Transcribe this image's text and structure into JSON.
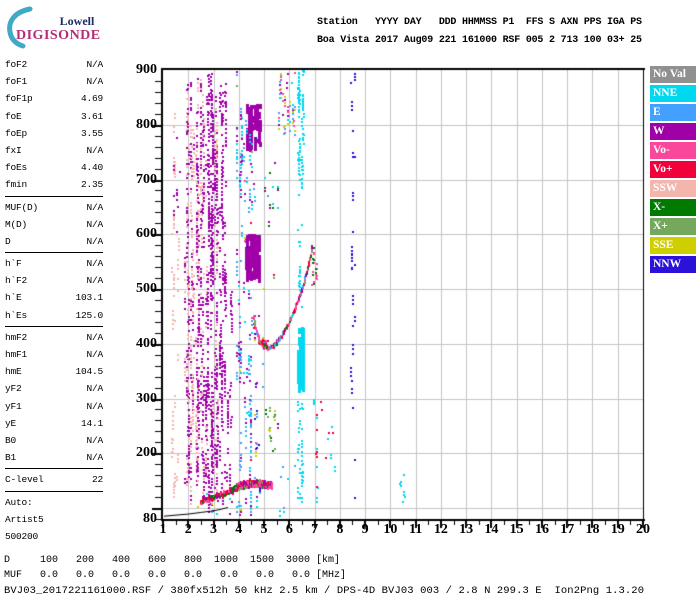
{
  "logo": {
    "line1": "Lowell",
    "line2": "DIGISONDE"
  },
  "header": {
    "line1": "Station   YYYY DAY   DDD HHMMSS P1  FFS S AXN PPS IGA PS",
    "line2": "Boa Vista 2017 Aug09 221 161000 RSF 005 2 713 100 03+ 25"
  },
  "params": [
    {
      "label": "foF2",
      "value": "N/A"
    },
    {
      "label": "foF1",
      "value": "N/A"
    },
    {
      "label": "foF1p",
      "value": "4.69"
    },
    {
      "label": "foE",
      "value": "3.61"
    },
    {
      "label": "foEp",
      "value": "3.55"
    },
    {
      "label": "fxI",
      "value": "N/A"
    },
    {
      "label": "foEs",
      "value": "4.40"
    },
    {
      "label": "fmin",
      "value": "2.35"
    },
    {
      "divider": true
    },
    {
      "label": "MUF(D)",
      "value": "N/A"
    },
    {
      "label": "M(D)",
      "value": "N/A"
    },
    {
      "label": "D",
      "value": "N/A"
    },
    {
      "divider": true
    },
    {
      "label": "h`F",
      "value": "N/A"
    },
    {
      "label": "h`F2",
      "value": "N/A"
    },
    {
      "label": "h`E",
      "value": "103.1"
    },
    {
      "label": "h`Es",
      "value": "125.0"
    },
    {
      "divider": true
    },
    {
      "label": "hmF2",
      "value": "N/A"
    },
    {
      "label": "hmF1",
      "value": "N/A"
    },
    {
      "label": "hmE",
      "value": "104.5"
    },
    {
      "label": "yF2",
      "value": "N/A"
    },
    {
      "label": "yF1",
      "value": "N/A"
    },
    {
      "label": "yE",
      "value": "14.1"
    },
    {
      "label": "B0",
      "value": "N/A"
    },
    {
      "label": "B1",
      "value": "N/A"
    },
    {
      "divider": true
    },
    {
      "label": "C-level",
      "value": "22"
    },
    {
      "divider": true
    },
    {
      "label": "Auto:",
      "value": ""
    },
    {
      "label": "Artist5",
      "value": ""
    },
    {
      "label": "500200",
      "value": ""
    }
  ],
  "legend": [
    {
      "key": "NoVal",
      "label": "No Val"
    },
    {
      "key": "NNE",
      "label": "NNE"
    },
    {
      "key": "E",
      "label": "E"
    },
    {
      "key": "W",
      "label": "W"
    },
    {
      "key": "Vo-",
      "label": "Vo-"
    },
    {
      "key": "Vo+",
      "label": "Vo+"
    },
    {
      "key": "SSW",
      "label": "SSW"
    },
    {
      "key": "X-",
      "label": "X-"
    },
    {
      "key": "X+",
      "label": "X+"
    },
    {
      "key": "SSE",
      "label": "SSE"
    },
    {
      "key": "NNW",
      "label": "NNW"
    }
  ],
  "footer": {
    "d_row": "D     100   200   400   600   800  1000  1500  3000 [km]",
    "muf_row": "MUF   0.0   0.0   0.0   0.0   0.0   0.0   0.0   0.0 [MHz]",
    "file_row": "BVJ03_2017221161000.RSF / 380fx512h 50 kHz 2.5 km / DPS-4D BVJ03 003 / 2.8 N 299.3 E  Ion2Png 1.3.20"
  },
  "chart_data": {
    "type": "scatter",
    "title": "Digisonde ionogram Boa Vista 2017 Aug09 221 161000",
    "xlabel": "[MHz]",
    "ylabel": "[km]",
    "xlim": [
      1,
      20
    ],
    "ylim": [
      80,
      900
    ],
    "grid": true,
    "x_ticks": [
      1,
      2,
      3,
      4,
      5,
      6,
      7,
      8,
      9,
      10,
      11,
      12,
      13,
      14,
      15,
      16,
      17,
      18,
      19,
      20
    ],
    "y_ticks": [
      900,
      800,
      700,
      600,
      500,
      400,
      300,
      200,
      80
    ],
    "x_minor_step": 0.5,
    "y_minor_step": 20,
    "seed": 1337,
    "colors": {
      "NoVal": "#909090",
      "NNE": "#00d8f0",
      "E": "#44a0ff",
      "W": "#a000a8",
      "Vo-": "#fa469b",
      "Vo+": "#f2003c",
      "SSW": "#f4b5ad",
      "X-": "#007a00",
      "X+": "#74a85c",
      "SSE": "#cfcf00",
      "NNW": "#2a12d8"
    },
    "clusters": [
      {
        "f": [
          1.28,
          1.62
        ],
        "km": [
          110,
          830
        ],
        "c": [
          "SSW"
        ],
        "n": 26,
        "len": [
          5,
          45
        ]
      },
      {
        "f": [
          1.38,
          1.66
        ],
        "km": [
          560,
          780
        ],
        "c": [
          "W"
        ],
        "n": 10,
        "len": [
          5,
          25
        ]
      },
      {
        "f": [
          1.84,
          2.06
        ],
        "km": [
          95,
          880
        ],
        "c": [
          "W",
          "W",
          "SSW"
        ],
        "n": 55,
        "len": [
          8,
          70
        ]
      },
      {
        "f": [
          2.06,
          2.26
        ],
        "km": [
          140,
          800
        ],
        "c": [
          "SSW",
          "SSW",
          "W"
        ],
        "n": 35,
        "len": [
          8,
          60
        ]
      },
      {
        "f": [
          2.28,
          2.52
        ],
        "km": [
          90,
          885
        ],
        "c": [
          "W",
          "W",
          "SSW"
        ],
        "n": 60,
        "len": [
          8,
          80
        ]
      },
      {
        "f": [
          2.52,
          2.72
        ],
        "km": [
          90,
          860
        ],
        "c": [
          "SSW",
          "W",
          "W"
        ],
        "n": 45,
        "len": [
          8,
          60
        ]
      },
      {
        "f": [
          2.74,
          2.96
        ],
        "km": [
          85,
          895
        ],
        "c": [
          "W"
        ],
        "n": 70,
        "len": [
          10,
          90
        ]
      },
      {
        "f": [
          2.96,
          3.16
        ],
        "km": [
          90,
          900
        ],
        "c": [
          "W",
          "W",
          "SSW"
        ],
        "n": 50,
        "len": [
          8,
          60
        ]
      },
      {
        "f": [
          3.18,
          3.46
        ],
        "km": [
          90,
          880
        ],
        "c": [
          "W"
        ],
        "n": 55,
        "len": [
          8,
          70
        ]
      },
      {
        "f": [
          3.5,
          3.72
        ],
        "km": [
          140,
          560
        ],
        "c": [
          "W"
        ],
        "n": 18,
        "len": [
          5,
          40
        ]
      },
      {
        "f": [
          3.88,
          4.16
        ],
        "km": [
          85,
          900
        ],
        "c": [
          "E",
          "NNE",
          "W"
        ],
        "n": 35,
        "len": [
          5,
          50
        ]
      },
      {
        "f": [
          4.18,
          4.52
        ],
        "km": [
          85,
          500
        ],
        "c": [
          "W",
          "E",
          "NNE"
        ],
        "n": 30,
        "len": [
          5,
          40
        ]
      },
      {
        "f": [
          4.25,
          4.78
        ],
        "km": [
          515,
          600
        ],
        "c": [
          "W"
        ],
        "n": 55,
        "len": [
          5,
          30
        ],
        "solid": true,
        "w": 3
      },
      {
        "f": [
          4.3,
          4.82
        ],
        "km": [
          755,
          838
        ],
        "c": [
          "W"
        ],
        "n": 50,
        "len": [
          5,
          30
        ],
        "solid": true,
        "w": 3
      },
      {
        "f": [
          3.9,
          4.6
        ],
        "km": [
          640,
          835
        ],
        "c": [
          "E",
          "W",
          "NNE"
        ],
        "n": 28,
        "len": [
          4,
          25
        ]
      },
      {
        "f": [
          4.55,
          4.95
        ],
        "km": [
          100,
          460
        ],
        "c": [
          "W",
          "E",
          "NNW",
          "SSE"
        ],
        "n": 18,
        "len": [
          3,
          15
        ]
      },
      {
        "f": [
          4.95,
          5.5
        ],
        "km": [
          600,
          745
        ],
        "c": [
          "X-",
          "NNE",
          "W"
        ],
        "n": 14,
        "len": [
          3,
          12
        ]
      },
      {
        "f": [
          5.05,
          5.5
        ],
        "km": [
          200,
          285
        ],
        "c": [
          "X-",
          "X+",
          "SSE"
        ],
        "n": 14,
        "len": [
          3,
          14
        ]
      },
      {
        "f": [
          5.5,
          6.3
        ],
        "km": [
          780,
          900
        ],
        "c": [
          "E",
          "NNE",
          "W",
          "SSE",
          "Vo-"
        ],
        "n": 42,
        "len": [
          3,
          20
        ]
      },
      {
        "f": [
          6.3,
          6.52
        ],
        "km": [
          300,
          430
        ],
        "c": [
          "NNE"
        ],
        "n": 36,
        "len": [
          10,
          60
        ],
        "solid": true,
        "w": 3
      },
      {
        "f": [
          6.3,
          6.52
        ],
        "km": [
          85,
          300
        ],
        "c": [
          "NNE"
        ],
        "n": 20,
        "len": [
          5,
          30
        ]
      },
      {
        "f": [
          6.3,
          6.52
        ],
        "km": [
          430,
          710
        ],
        "c": [
          "NNE"
        ],
        "n": 16,
        "len": [
          5,
          25
        ]
      },
      {
        "f": [
          6.3,
          6.56
        ],
        "km": [
          710,
          900
        ],
        "c": [
          "NNE"
        ],
        "n": 30,
        "len": [
          8,
          40
        ]
      },
      {
        "f": [
          6.85,
          7.06
        ],
        "km": [
          490,
          595
        ],
        "c": [
          "X-",
          "Vo-"
        ],
        "n": 14,
        "len": [
          4,
          20
        ]
      },
      {
        "f": [
          6.9,
          7.25
        ],
        "km": [
          100,
          310
        ],
        "c": [
          "NNE",
          "Vo+"
        ],
        "n": 14,
        "len": [
          3,
          15
        ]
      },
      {
        "f": [
          7.4,
          7.75
        ],
        "km": [
          120,
          260
        ],
        "c": [
          "Vo+",
          "NNE"
        ],
        "n": 8,
        "len": [
          3,
          10
        ]
      },
      {
        "f": [
          8.38,
          8.56
        ],
        "km": [
          100,
          895
        ],
        "c": [
          "NNW"
        ],
        "n": 22,
        "len": [
          4,
          30
        ]
      },
      {
        "f": [
          10.35,
          10.56
        ],
        "km": [
          95,
          165
        ],
        "c": [
          "NNE"
        ],
        "n": 7,
        "len": [
          4,
          15
        ]
      },
      {
        "f": [
          3.8,
          5.6
        ],
        "km": [
          100,
          880
        ],
        "c": [
          "SSE",
          "NNW",
          "Vo-",
          "X+",
          "E",
          "Vo+"
        ],
        "n": 30,
        "len": [
          3,
          8
        ]
      },
      {
        "f": [
          1.9,
          4.8
        ],
        "km": [
          82,
          130
        ],
        "c": [
          "W",
          "E",
          "NNE",
          "Vo+",
          "SSE"
        ],
        "n": 26,
        "len": [
          3,
          10
        ]
      },
      {
        "f": [
          9.38,
          9.46
        ],
        "km": [
          595,
          615
        ],
        "c": [
          "NNW"
        ],
        "n": 1,
        "len": [
          4,
          8
        ]
      },
      {
        "f": [
          5.6,
          6.2
        ],
        "km": [
          85,
          180
        ],
        "c": [
          "NNE",
          "E"
        ],
        "n": 8,
        "len": [
          3,
          12
        ]
      },
      {
        "f": [
          4.72,
          5.12
        ],
        "km": [
          393,
          409
        ],
        "c": [
          "Vo+",
          "Vo+",
          "Vo-"
        ],
        "n": 28,
        "len": [
          3,
          8
        ]
      },
      {
        "f": [
          4.5,
          4.64
        ],
        "km": [
          424,
          456
        ],
        "c": [
          "Vo+",
          "Vo-"
        ],
        "n": 8,
        "len": [
          3,
          10
        ]
      }
    ],
    "traces": [
      {
        "name": "f-trace",
        "points": [
          [
            4.55,
            452
          ],
          [
            4.62,
            435
          ],
          [
            4.7,
            421
          ],
          [
            4.78,
            411
          ],
          [
            4.88,
            403
          ],
          [
            5.0,
            398
          ],
          [
            5.12,
            395
          ],
          [
            5.25,
            396
          ],
          [
            5.4,
            401
          ],
          [
            5.55,
            409
          ],
          [
            5.7,
            419
          ],
          [
            5.85,
            431
          ],
          [
            6.0,
            445
          ],
          [
            6.15,
            461
          ],
          [
            6.3,
            479
          ],
          [
            6.45,
            499
          ],
          [
            6.6,
            522
          ],
          [
            6.72,
            545
          ],
          [
            6.82,
            565
          ],
          [
            6.9,
            585
          ]
        ],
        "colors": [
          "Vo-",
          "Vo-",
          "Vo+",
          "W",
          "Vo-",
          "X-",
          "E",
          "NNE",
          "Vo-",
          "Vo+",
          "X+"
        ],
        "jitter": 2.5,
        "density": 2
      },
      {
        "name": "es-left",
        "points": [
          [
            2.45,
            114
          ],
          [
            2.7,
            118
          ],
          [
            2.95,
            122
          ],
          [
            3.2,
            126
          ],
          [
            3.45,
            131
          ],
          [
            3.7,
            136
          ],
          [
            3.9,
            140
          ]
        ],
        "colors": [
          "Vo+",
          "Vo+",
          "X-",
          "Vo-",
          "W"
        ],
        "jitter": 4,
        "density": 2
      },
      {
        "name": "es-right",
        "points": [
          [
            3.9,
            141
          ],
          [
            4.1,
            144
          ],
          [
            4.3,
            146
          ],
          [
            4.5,
            147
          ],
          [
            4.7,
            147
          ],
          [
            4.9,
            146
          ],
          [
            5.1,
            145
          ],
          [
            5.3,
            144
          ]
        ],
        "colors": [
          "W",
          "Vo+",
          "Vo-",
          "X-",
          "X+",
          "W",
          "Vo-",
          "W",
          "Vo+"
        ],
        "jitter": 6,
        "density": 4
      }
    ],
    "black_line": [
      [
        1.02,
        86
      ],
      [
        1.5,
        88
      ],
      [
        2.0,
        90
      ],
      [
        2.5,
        93
      ],
      [
        3.0,
        96
      ],
      [
        3.3,
        99
      ],
      [
        3.55,
        102
      ]
    ],
    "grid_color": "#c5c5c5"
  }
}
